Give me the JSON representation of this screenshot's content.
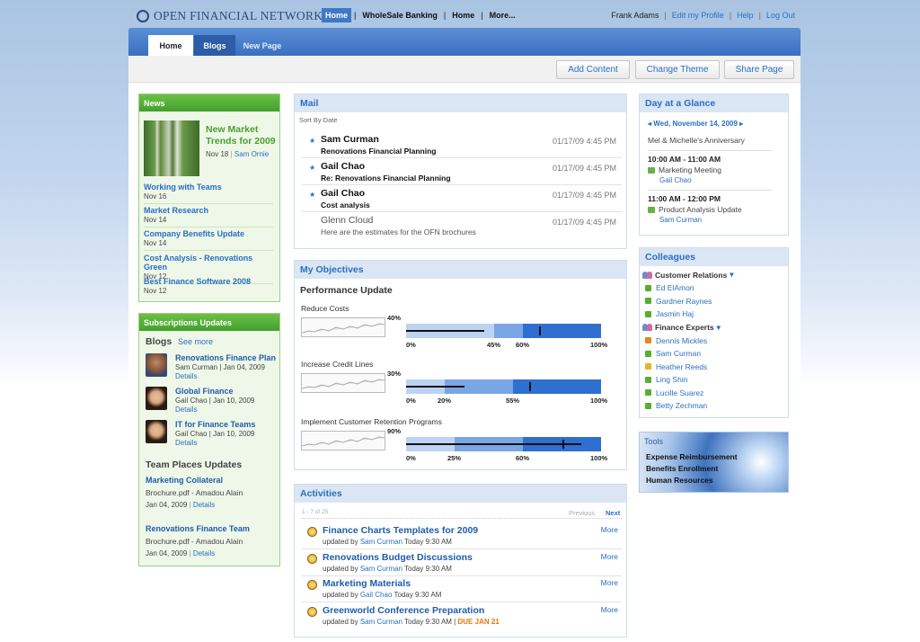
{
  "brand": {
    "name": "Open Financial Network"
  },
  "topnav": {
    "items": [
      "Home",
      "WholeSale Banking",
      "Home",
      "More..."
    ]
  },
  "user": {
    "name": "Frank Adams",
    "links": [
      "Edit my Profile",
      "Help",
      "Log Out"
    ]
  },
  "tabs": [
    "Home",
    "Blogs",
    "New Page"
  ],
  "actions": [
    "Add Content",
    "Change Theme",
    "Share Page"
  ],
  "news": {
    "title": "News",
    "featured": {
      "title": "New Market Trends for 2009",
      "date": "Nov 18",
      "author": "Sam Ornie"
    },
    "items": [
      {
        "title": "Working with Teams",
        "date": "Nov 16"
      },
      {
        "title": "Market Research",
        "date": "Nov 14"
      },
      {
        "title": "Company Benefits Update",
        "date": "Nov 14"
      },
      {
        "title": "Cost Analysis - Renovations Green",
        "date": "Nov 12"
      },
      {
        "title": "Best Finance Software 2008",
        "date": "Nov 12"
      }
    ]
  },
  "subs": {
    "title": "Subscriptions Updates",
    "blogs_heading": "Blogs",
    "see_more": "See more",
    "blogs": [
      {
        "title": "Renovations Finance Plan",
        "meta": "Sam Curman | Jan 04, 2009",
        "link": "Details"
      },
      {
        "title": "Global Finance",
        "meta": "Gail Chao | Jan 10, 2009",
        "link": "Details"
      },
      {
        "title": "IT for Finance Teams",
        "meta": "Gail Chao | Jan 10, 2009",
        "link": "Details"
      }
    ],
    "team_heading": "Team Places Updates",
    "teams": [
      {
        "title": "Marketing Collateral",
        "file": "Brochure.pdf - Amadou Alain",
        "date": "Jan 04, 2009",
        "link": "Details"
      },
      {
        "title": "Renovations Finance Team",
        "file": "Brochure.pdf - Amadou Alain",
        "date": "Jan 04, 2009",
        "link": "Details"
      }
    ]
  },
  "mail": {
    "title": "Mail",
    "sort": "Sort By Date",
    "rows": [
      {
        "from": "Sam Curman",
        "subject": "Renovations Financial Planning",
        "date": "01/17/09 4:45 PM",
        "unread": true
      },
      {
        "from": "Gail Chao",
        "subject": "Re: Renovations Financial Planning",
        "date": "01/17/09 4:45 PM",
        "unread": true
      },
      {
        "from": "Gail Chao",
        "subject": "Cost analysis",
        "date": "01/17/09 4:45 PM",
        "unread": true
      },
      {
        "from": "Glenn Cloud",
        "subject": "Here are the estimates for the OFN brochures",
        "date": "01/17/09 4:45 PM",
        "unread": false
      }
    ]
  },
  "objectives": {
    "title": "My Objectives",
    "subtitle": "Performance Update",
    "items": [
      {
        "label": "Reduce Costs",
        "top": "40%",
        "ticks": [
          "0%",
          "45%",
          "60%",
          "100%"
        ],
        "tick_values": [
          0,
          45,
          60,
          100
        ],
        "current": 40,
        "marker": 68
      },
      {
        "label": "Increase Credit Lines",
        "top": "30%",
        "ticks": [
          "0%",
          "20%",
          "55%",
          "100%"
        ],
        "tick_values": [
          0,
          20,
          55,
          100
        ],
        "current": 30,
        "marker": 63
      },
      {
        "label": "Implement Customer Retention Programs",
        "top": "90%",
        "ticks": [
          "0%",
          "25%",
          "60%",
          "100%"
        ],
        "tick_values": [
          0,
          25,
          60,
          100
        ],
        "current": 90,
        "marker": 80
      }
    ]
  },
  "activities": {
    "title": "Activities",
    "paging": "1 - 7 of 25",
    "prev": "Previous",
    "next": "Next",
    "rows": [
      {
        "title": "Finance Charts Templates for 2009",
        "pre": "updated by",
        "by": "Sam Curman",
        "when": "Today 9:30 AM",
        "more": "More",
        "due": ""
      },
      {
        "title": "Renovations Budget Discussions",
        "pre": "updated by",
        "by": "Sam Curman",
        "when": "Today 9:30 AM",
        "more": "More",
        "due": ""
      },
      {
        "title": "Marketing Materials",
        "pre": "updated by",
        "by": "Gail Chao",
        "when": "Today 9:30 AM",
        "more": "More",
        "due": ""
      },
      {
        "title": "Greenworld Conference Preparation",
        "pre": "updated by",
        "by": "Sam Curman",
        "when": "Today 9:30 AM |",
        "more": "More",
        "due": "DUE JAN 21"
      }
    ]
  },
  "day": {
    "title": "Day at a Glance",
    "date": "Wed, November 14, 2009",
    "note": "Mel & Michelle's Anniversary",
    "events": [
      {
        "time": "10:00 AM - 11:00 AM",
        "title": "Marketing Meeting",
        "who": "Gail Chao"
      },
      {
        "time": "11:00 AM - 12:00 PM",
        "title": "Product Analysis Update",
        "who": "Sam Curman"
      }
    ]
  },
  "colleagues": {
    "title": "Colleagues",
    "groups": [
      {
        "name": "Customer Relations",
        "people": [
          {
            "n": "Ed ElAmon",
            "c": "#55b030"
          },
          {
            "n": "Gardner Raynes",
            "c": "#55b030"
          },
          {
            "n": "Jasmin Haj",
            "c": "#55b030"
          }
        ]
      },
      {
        "name": "Finance Experts",
        "people": [
          {
            "n": "Dennis Mickles",
            "c": "#e08a20"
          },
          {
            "n": "Sam Curman",
            "c": "#55b030"
          },
          {
            "n": "Heather Reeds",
            "c": "#e6b420"
          },
          {
            "n": "Ling Shin",
            "c": "#55b030"
          },
          {
            "n": "Lucille Suarez",
            "c": "#55b030"
          },
          {
            "n": "Betty Zechman",
            "c": "#55b030"
          }
        ]
      }
    ]
  },
  "tools": {
    "title": "Tools",
    "items": [
      "Expense Reimbursement",
      "Benefits Enrollment",
      "Human Resources"
    ]
  }
}
